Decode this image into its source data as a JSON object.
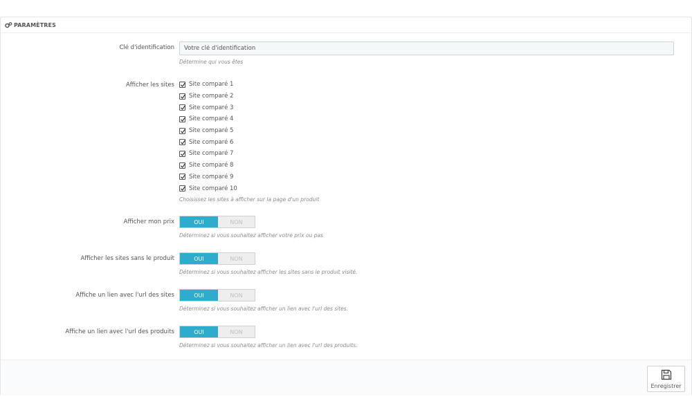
{
  "panel": {
    "title": "PARAMÈTRES",
    "title_icon": "gears-icon"
  },
  "identification": {
    "label": "Clé d'identification",
    "value": "Votre clé d'identification",
    "help": "Détermine qui vous êtes"
  },
  "sites": {
    "label": "Afficher les sites",
    "items": [
      {
        "label": "Site comparé 1",
        "checked": true
      },
      {
        "label": "Site comparé 2",
        "checked": true
      },
      {
        "label": "Site comparé 3",
        "checked": true
      },
      {
        "label": "Site comparé 4",
        "checked": true
      },
      {
        "label": "Site comparé 5",
        "checked": true
      },
      {
        "label": "Site comparé 6",
        "checked": true
      },
      {
        "label": "Site comparé 7",
        "checked": true
      },
      {
        "label": "Site comparé 8",
        "checked": true
      },
      {
        "label": "Site comparé 9",
        "checked": true
      },
      {
        "label": "Site comparé 10",
        "checked": true
      }
    ],
    "help": "Choisissez les sites à afficher sur la page d'un produit"
  },
  "toggles": [
    {
      "label": "Afficher mon prix",
      "on": "OUI",
      "off": "NON",
      "selected": "OUI",
      "help": "Déterminez si vous souhaitez afficher votre prix ou pas"
    },
    {
      "label": "Afficher les sites sans le produit",
      "on": "OUI",
      "off": "NON",
      "selected": "OUI",
      "help": "Déterminez si vous souhaitez afficher les sites sans le produit visité."
    },
    {
      "label": "Affiche un lien avec l'url des sites",
      "on": "OUI",
      "off": "NON",
      "selected": "OUI",
      "help": "Déterminez si vous souhaitez afficher un lien avec l'url des sites."
    },
    {
      "label": "Affiche un lien avec l'url des produits",
      "on": "OUI",
      "off": "NON",
      "selected": "OUI",
      "help": "Déterminez si vous souhaitez afficher un lien avec l'url des produits."
    }
  ],
  "footer": {
    "save_label": "Enregistrer",
    "save_icon": "floppy-disk-icon"
  },
  "colors": {
    "accent": "#2eacce",
    "switch_off_bg": "#eeeeee",
    "input_bg": "#f5f8f9"
  }
}
